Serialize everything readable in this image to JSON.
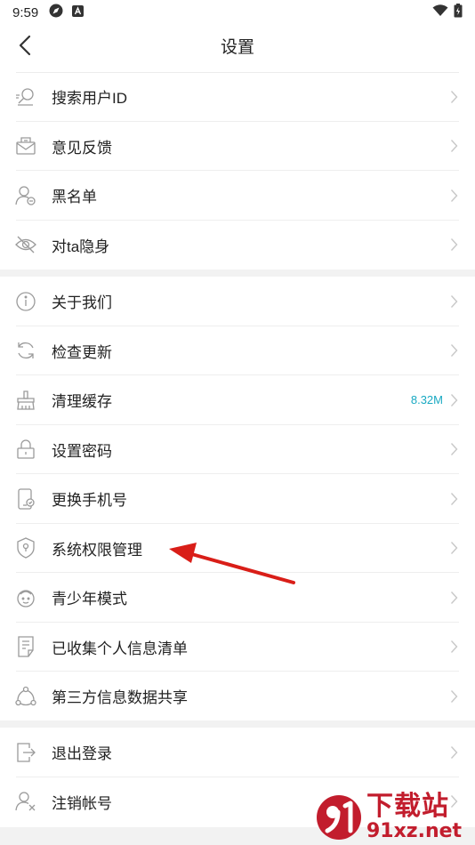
{
  "status_bar": {
    "time": "9:59",
    "icons_left": [
      "compass-icon",
      "a-badge-icon"
    ],
    "icons_right": [
      "wifi-icon",
      "battery-icon"
    ]
  },
  "header": {
    "title": "设置"
  },
  "groups": [
    {
      "items": [
        {
          "label": "搜索用户ID",
          "icon": "search-user-icon"
        },
        {
          "label": "意见反馈",
          "icon": "feedback-icon"
        },
        {
          "label": "黑名单",
          "icon": "blacklist-icon"
        },
        {
          "label": "对ta隐身",
          "icon": "invisible-icon"
        }
      ]
    },
    {
      "items": [
        {
          "label": "关于我们",
          "icon": "info-icon"
        },
        {
          "label": "检查更新",
          "icon": "refresh-icon"
        },
        {
          "label": "清理缓存",
          "icon": "broom-icon",
          "value": "8.32M"
        },
        {
          "label": "设置密码",
          "icon": "lock-icon"
        },
        {
          "label": "更换手机号",
          "icon": "phone-icon"
        },
        {
          "label": "系统权限管理",
          "icon": "shield-icon"
        },
        {
          "label": "青少年模式",
          "icon": "child-face-icon"
        },
        {
          "label": "已收集个人信息清单",
          "icon": "document-list-icon"
        },
        {
          "label": "第三方信息数据共享",
          "icon": "share-icon"
        }
      ]
    },
    {
      "items": [
        {
          "label": "退出登录",
          "icon": "logout-icon"
        },
        {
          "label": "注销帐号",
          "icon": "remove-account-icon"
        }
      ]
    }
  ],
  "colors": {
    "accent_value": "#19a9c2",
    "annotation_arrow": "#d91e18",
    "watermark": "#c21d2d"
  },
  "watermark": {
    "line1": "下载站",
    "line2": "91xz.net"
  }
}
